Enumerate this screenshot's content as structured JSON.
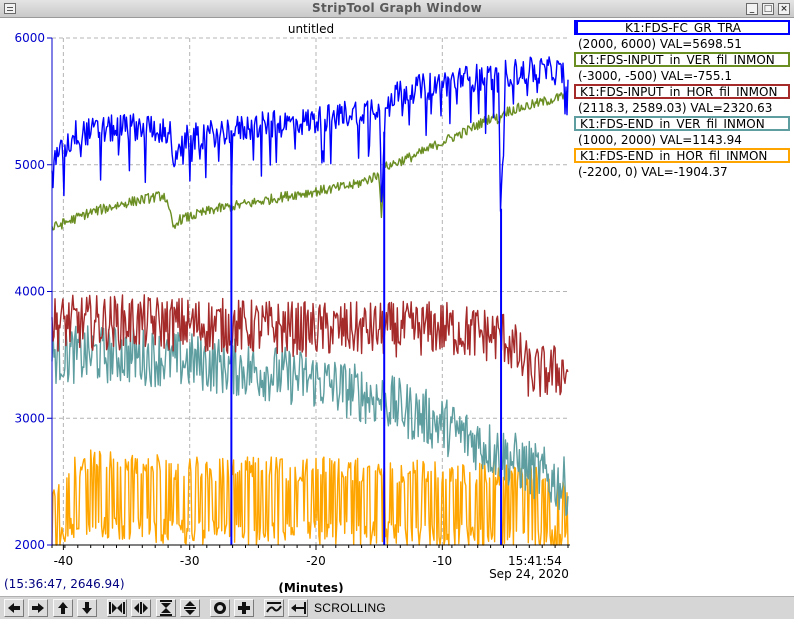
{
  "window": {
    "title": "StripTool Graph Window",
    "minimize_glyph": "_",
    "maximize_glyph": "□",
    "close_glyph": "×"
  },
  "plot": {
    "title": "untitled",
    "y_ticks": [
      "6000",
      "5000",
      "4000",
      "3000",
      "2000"
    ],
    "x_ticks": [
      "-40",
      "-30",
      "-20",
      "-10"
    ],
    "x_unit_label": "(Minutes)",
    "end_time": "15:41:54",
    "end_date": "Sep 24, 2020",
    "cursor_readout": "(15:36:47, 2646.94)",
    "axis_color": "#0000cc",
    "grid": true
  },
  "legend": [
    {
      "name": "K1:FDS-FC_GR_TRA",
      "range": "(2000, 6000) VAL=5698.51",
      "color": "#0000ff"
    },
    {
      "name": "K1:FDS-INPUT_in_VER_fil_INMON",
      "range": "(-3000, -500) VAL=-755.1",
      "color": "#6b8e23"
    },
    {
      "name": "K1:FDS-INPUT_in_HOR_fil_INMON",
      "range": "(2118.3, 2589.03) VAL=2320.63",
      "color": "#a52a2a"
    },
    {
      "name": "K1:FDS-END_in_VER_fil_INMON",
      "range": "(1000, 2000) VAL=1143.94",
      "color": "#5f9ea0"
    },
    {
      "name": "K1:FDS-END_in_HOR_fil_INMON",
      "range": "(-2200, 0) VAL=-1904.37",
      "color": "#ffa500"
    }
  ],
  "toolbar": {
    "buttons": [
      {
        "name": "scroll-left-button",
        "icon": "arrow-left-icon"
      },
      {
        "name": "scroll-right-button",
        "icon": "arrow-right-icon"
      },
      {
        "name": "scroll-up-button",
        "icon": "arrow-up-icon"
      },
      {
        "name": "scroll-down-button",
        "icon": "arrow-down-icon"
      },
      {
        "name": "zoom-in-time-button",
        "icon": "zoom-in-x-icon"
      },
      {
        "name": "zoom-out-time-button",
        "icon": "zoom-out-x-icon"
      },
      {
        "name": "zoom-in-y-button",
        "icon": "zoom-in-y-icon"
      },
      {
        "name": "zoom-out-y-button",
        "icon": "zoom-out-y-icon"
      },
      {
        "name": "auto-scale-button",
        "icon": "target-icon"
      },
      {
        "name": "reset-button",
        "icon": "plus-icon"
      },
      {
        "name": "refresh-button",
        "icon": "refresh-icon"
      },
      {
        "name": "pan-button",
        "icon": "pan-icon"
      }
    ],
    "mode_label": "SCROLLING"
  },
  "chart_data": {
    "type": "line",
    "title": "untitled",
    "xlabel": "(Minutes)",
    "ylabel": "",
    "x_range": [
      -40.9,
      -0.05
    ],
    "ylim": [
      2000,
      6000
    ],
    "y_ticks": [
      2000,
      3000,
      4000,
      5000,
      6000
    ],
    "x_ticks": [
      -40,
      -30,
      -20,
      -10
    ],
    "grid": true,
    "legend_position": "right",
    "series": [
      {
        "name": "K1:FDS-FC_GR_TRA",
        "color": "#0000ff",
        "x": [
          -40.9,
          -39,
          -37,
          -35,
          -33,
          -31.5,
          -31.2,
          -30.5,
          -28,
          -25,
          -20,
          -18,
          -16,
          -15,
          -14.8,
          -14.5,
          -12,
          -10,
          -8,
          -6,
          -5.5,
          -5.4,
          -5,
          -3,
          -1,
          -0.05
        ],
        "y": [
          5000,
          5250,
          5270,
          5300,
          5300,
          5250,
          4970,
          5200,
          5250,
          5300,
          5350,
          5400,
          5430,
          5480,
          4700,
          5540,
          5600,
          5640,
          5680,
          5700,
          5650,
          4500,
          5720,
          5740,
          5740,
          5700
        ]
      },
      {
        "name": "K1:FDS-INPUT_in_VER_fil_INMON",
        "color": "#6b8e23",
        "x": [
          -40.9,
          -38,
          -35,
          -32,
          -31.2,
          -31,
          -28,
          -25,
          -22,
          -20,
          -17,
          -15,
          -14.8,
          -14.6,
          -12,
          -10,
          -8,
          -6,
          -5.4,
          -5.3,
          -3,
          -0.05
        ],
        "y": [
          4500,
          4620,
          4700,
          4760,
          4480,
          4560,
          4650,
          4700,
          4760,
          4790,
          4840,
          4920,
          4580,
          4980,
          5080,
          5180,
          5270,
          5380,
          5350,
          5410,
          5470,
          5550
        ]
      },
      {
        "name": "K1:FDS-INPUT_in_HOR_fil_INMON",
        "color": "#a52a2a",
        "x": [
          -40.9,
          -35,
          -30,
          -25,
          -20,
          -15,
          -10,
          -5,
          -3,
          -0.05
        ],
        "y": [
          3750,
          3760,
          3740,
          3720,
          3700,
          3700,
          3710,
          3640,
          3350,
          3380
        ]
      },
      {
        "name": "K1:FDS-END_in_VER_fil_INMON",
        "color": "#5f9ea0",
        "x": [
          -40.9,
          -35,
          -30,
          -25,
          -20,
          -15,
          -10,
          -5,
          -0.05
        ],
        "y": [
          3500,
          3500,
          3450,
          3380,
          3300,
          3150,
          2950,
          2700,
          2450
        ]
      },
      {
        "name": "K1:FDS-END_in_HOR_fil_INMON",
        "color": "#ffa500",
        "x": [
          -40.9,
          -40,
          -38,
          -30,
          -20,
          -10,
          -1,
          -0.05
        ],
        "y": [
          2100,
          2350,
          2400,
          2350,
          2350,
          2320,
          2300,
          2250
        ]
      }
    ],
    "drop_spikes": [
      {
        "series": "K1:FDS-FC_GR_TRA",
        "x": -26.7,
        "to": 2000
      },
      {
        "series": "K1:FDS-FC_GR_TRA",
        "x": -14.6,
        "to": 2000
      },
      {
        "series": "K1:FDS-FC_GR_TRA",
        "x": -5.35,
        "to": 2000
      }
    ]
  }
}
